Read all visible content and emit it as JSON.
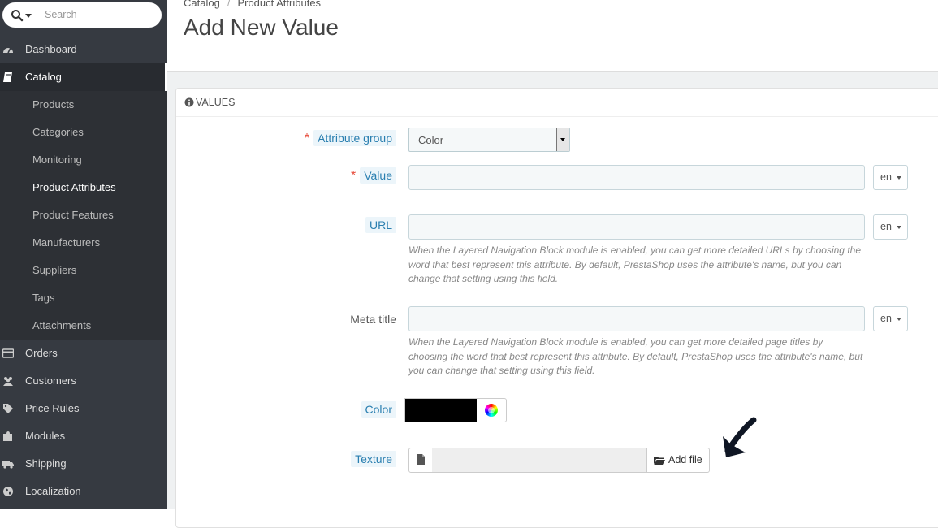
{
  "sidebar": {
    "search_placeholder": "Search",
    "items": [
      {
        "label": "Dashboard",
        "icon": "tachometer-icon"
      },
      {
        "label": "Catalog",
        "icon": "book-icon"
      },
      {
        "label": "Orders",
        "icon": "credit-card-icon"
      },
      {
        "label": "Customers",
        "icon": "users-icon"
      },
      {
        "label": "Price Rules",
        "icon": "tags-icon"
      },
      {
        "label": "Modules",
        "icon": "puzzle-icon"
      },
      {
        "label": "Shipping",
        "icon": "truck-icon"
      },
      {
        "label": "Localization",
        "icon": "globe-icon"
      }
    ],
    "catalog_sub": [
      "Products",
      "Categories",
      "Monitoring",
      "Product Attributes",
      "Product Features",
      "Manufacturers",
      "Suppliers",
      "Tags",
      "Attachments"
    ]
  },
  "breadcrumb": {
    "items": [
      "Catalog",
      "Product Attributes"
    ],
    "separator": "/"
  },
  "page_title": "Add New Value",
  "panel": {
    "heading": "VALUES",
    "fields": {
      "attribute_group": {
        "label": "Attribute group",
        "required": "*",
        "value": "Color"
      },
      "value": {
        "label": "Value",
        "required": "*",
        "lang": "en"
      },
      "url": {
        "label": "URL",
        "lang": "en",
        "help": "When the Layered Navigation Block module is enabled, you can get more detailed URLs by choosing the word that best represent this attribute. By default, PrestaShop uses the attribute's name, but you can change that setting using this field."
      },
      "meta_title": {
        "label": "Meta title",
        "lang": "en",
        "help": "When the Layered Navigation Block module is enabled, you can get more detailed page titles by choosing the word that best represent this attribute. By default, PrestaShop uses the attribute's name, but you can change that setting using this field."
      },
      "color": {
        "label": "Color",
        "value": "#000000"
      },
      "texture": {
        "label": "Texture",
        "button": "Add file"
      }
    }
  },
  "colors": {
    "sidebar_bg": "#363a41",
    "accent_blue": "#2a7fb0",
    "required_red": "#e74c3c"
  }
}
